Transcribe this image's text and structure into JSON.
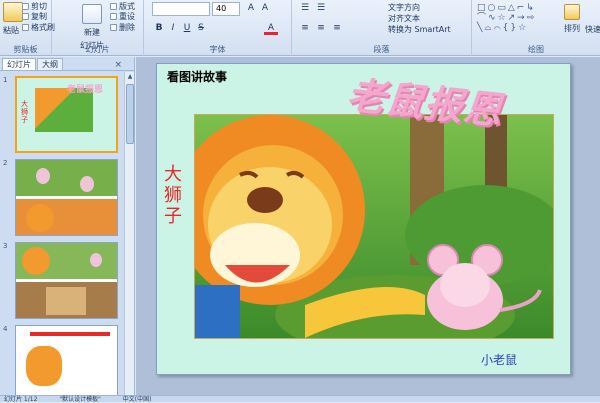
{
  "ribbon": {
    "clipboard": {
      "paste": "粘贴",
      "cut": "剪切",
      "copy": "复制",
      "format_painter": "格式刷",
      "label": "剪贴板"
    },
    "slides": {
      "new_slide": "新建",
      "new_slide_2": "幻灯片",
      "layout": "版式",
      "reset": "重设",
      "delete": "删除",
      "label": "幻灯片"
    },
    "font": {
      "size": "40",
      "label": "字体",
      "bold": "B",
      "italic": "I",
      "underline": "U",
      "strike": "S"
    },
    "paragraph": {
      "text_direction": "文字方向",
      "align_text": "对齐文本",
      "smartart": "转换为 SmartArt",
      "label": "段落"
    },
    "drawing": {
      "arrange": "排列",
      "quick": "快速",
      "label": "绘图"
    }
  },
  "panel": {
    "tab_slides": "幻灯片",
    "tab_outline": "大纲",
    "close": "×"
  },
  "thumbnails": [
    {
      "num": "1",
      "selected": true
    },
    {
      "num": "2",
      "selected": false
    },
    {
      "num": "3",
      "selected": false
    },
    {
      "num": "4",
      "selected": false
    }
  ],
  "slide": {
    "title": "看图讲故事",
    "art_title": "老鼠报恩",
    "lion_label": "大狮子",
    "mouse_label": "小老鼠"
  },
  "status": {
    "slide_count": "幻灯片 1/12",
    "theme": "\"默认设计模板\"",
    "lang": "中文(中国)"
  }
}
